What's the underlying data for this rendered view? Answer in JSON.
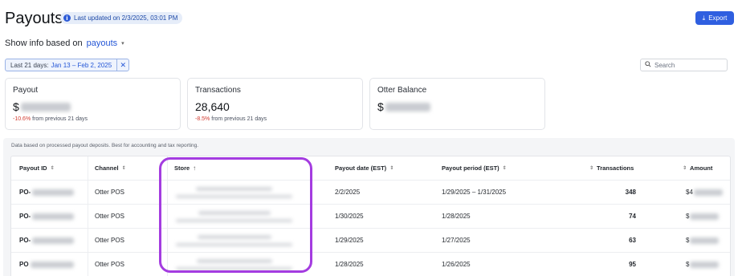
{
  "header": {
    "title": "Payouts",
    "updated_badge": "Last updated on 2/3/2025, 03:01 PM",
    "export_label": "Export"
  },
  "show_info": {
    "prefix": "Show info based on",
    "selected": "payouts"
  },
  "filter_chip": {
    "label": "Last 21 days:",
    "range": "Jan 13 – Feb 2, 2025"
  },
  "search": {
    "placeholder": "Search"
  },
  "cards": {
    "payout": {
      "label": "Payout",
      "value_prefix": "$",
      "delta": "-10.6%",
      "delta_suffix": "from previous 21 days"
    },
    "transactions": {
      "label": "Transactions",
      "value": "28,640",
      "delta": "-8.5%",
      "delta_suffix": "from previous 21 days"
    },
    "balance": {
      "label": "Otter Balance",
      "value_prefix": "$"
    }
  },
  "table": {
    "note": "Data based on processed payout deposits. Best for accounting and tax reporting.",
    "columns": {
      "payout_id": "Payout ID",
      "channel": "Channel",
      "store": "Store",
      "payout_date": "Payout date (EST)",
      "payout_period": "Payout period (EST)",
      "transactions": "Transactions",
      "amount": "Amount"
    },
    "rows": [
      {
        "payout_id": "PO-",
        "channel": "Otter POS",
        "payout_date": "2/2/2025",
        "payout_period": "1/29/2025 – 1/31/2025",
        "transactions": "348",
        "amount": "$4"
      },
      {
        "payout_id": "PO-",
        "channel": "Otter POS",
        "payout_date": "1/30/2025",
        "payout_period": "1/28/2025",
        "transactions": "74",
        "amount": "$"
      },
      {
        "payout_id": "PO-",
        "channel": "Otter POS",
        "payout_date": "1/29/2025",
        "payout_period": "1/27/2025",
        "transactions": "63",
        "amount": "$"
      },
      {
        "payout_id": "PO",
        "channel": "Otter POS",
        "payout_date": "1/28/2025",
        "payout_period": "1/26/2025",
        "transactions": "95",
        "amount": "$"
      }
    ]
  },
  "colors": {
    "accent": "#2f5fe0",
    "negative": "#d23a2f",
    "highlight": "#a43ce0"
  }
}
